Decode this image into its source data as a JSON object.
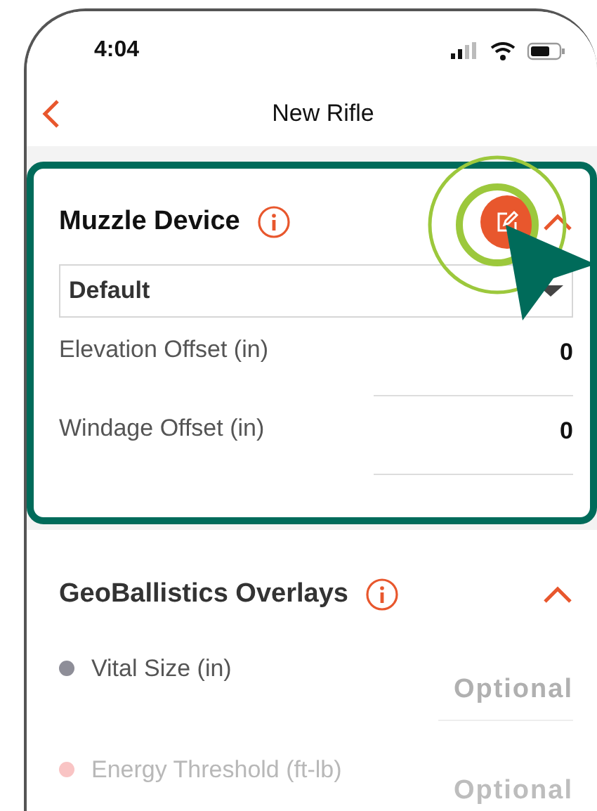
{
  "status_bar": {
    "time": "4:04"
  },
  "nav": {
    "title": "New Rifle"
  },
  "sections": [
    {
      "kind": "muzzle",
      "title": "Muzzle Device",
      "highlighted": true,
      "expanded": true,
      "edit_button": true,
      "dropdown": {
        "value": "Default"
      },
      "fields": [
        {
          "label": "Elevation Offset (in)",
          "value": "0"
        },
        {
          "label": "Windage Offset (in)",
          "value": "0"
        }
      ]
    },
    {
      "kind": "overlays",
      "title": "GeoBallistics Overlays",
      "highlighted": false,
      "expanded": true,
      "edit_button": false,
      "fields": [
        {
          "label": "Vital Size (in)",
          "placeholder": "Optional",
          "color": "#8e8e98"
        },
        {
          "label": "Energy Threshold (ft-lb)",
          "placeholder": "Optional",
          "color": "#f9c4c4"
        }
      ]
    }
  ]
}
